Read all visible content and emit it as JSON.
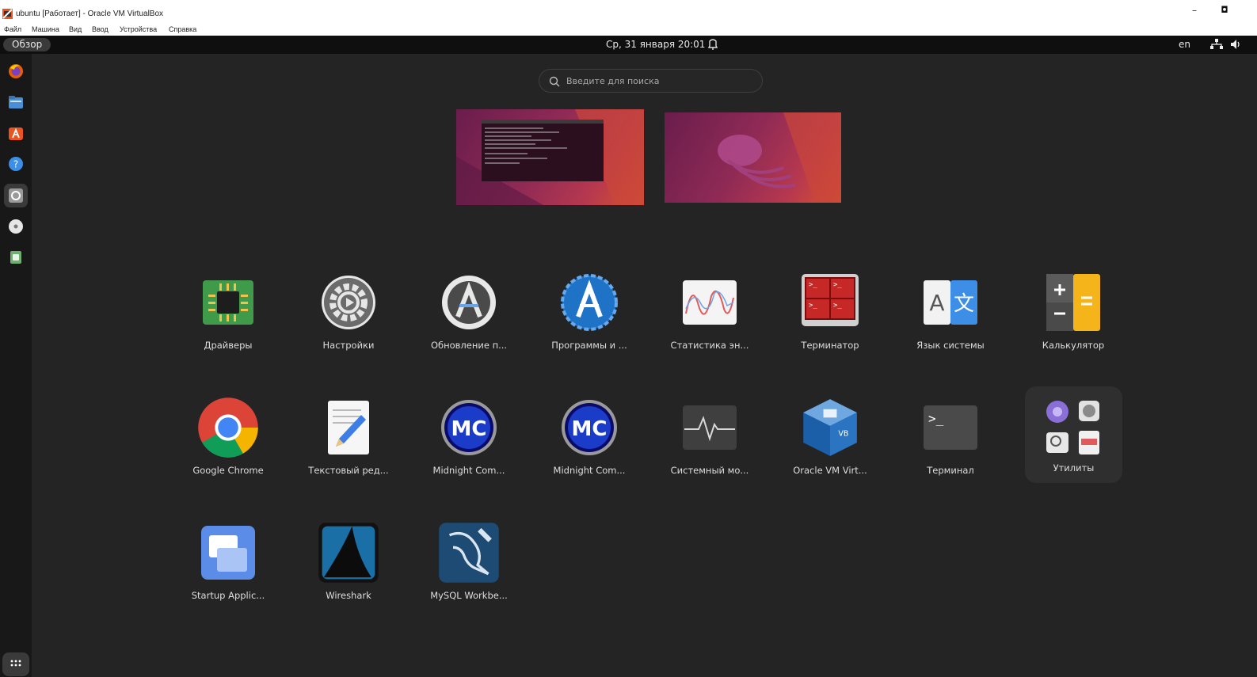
{
  "window": {
    "title": "ubuntu [Работает] - Oracle VM VirtualBox",
    "minimize": "–",
    "restore": "◘"
  },
  "menubar": [
    "Файл",
    "Машина",
    "Вид",
    "Ввод",
    "Устройства",
    "Справка"
  ],
  "topbar": {
    "activities": "Обзор",
    "clock": "Ср, 31 января  20:01",
    "lang": "en"
  },
  "search": {
    "placeholder": "Введите для поиска"
  },
  "dock": [
    {
      "name": "firefox-icon"
    },
    {
      "name": "files-icon"
    },
    {
      "name": "app-center-icon"
    },
    {
      "name": "help-icon"
    },
    {
      "name": "settings-icon",
      "active": true
    },
    {
      "name": "disc-icon"
    },
    {
      "name": "trash-icon"
    }
  ],
  "apps": [
    {
      "label": "Драйверы",
      "icon": "chip-icon"
    },
    {
      "label": "Настройки",
      "icon": "settings-gear-icon"
    },
    {
      "label": "Обновление п...",
      "icon": "software-updater-icon"
    },
    {
      "label": "Программы и ...",
      "icon": "software-properties-icon"
    },
    {
      "label": "Статистика эн...",
      "icon": "power-statistics-icon"
    },
    {
      "label": "Терминатор",
      "icon": "terminator-icon"
    },
    {
      "label": "Язык системы",
      "icon": "language-icon"
    },
    {
      "label": "Калькулятор",
      "icon": "calculator-icon"
    },
    {
      "label": "Google Chrome",
      "icon": "chrome-icon"
    },
    {
      "label": "Текстовый ред...",
      "icon": "text-editor-icon"
    },
    {
      "label": "Midnight Com...",
      "icon": "midnight-commander-icon"
    },
    {
      "label": "Midnight Com...",
      "icon": "midnight-commander-icon"
    },
    {
      "label": "Системный мо...",
      "icon": "system-monitor-icon"
    },
    {
      "label": "Oracle VM Virt...",
      "icon": "virtualbox-icon"
    },
    {
      "label": "Терминал",
      "icon": "terminal-icon"
    },
    {
      "label": "Утилиты",
      "icon": "utilities-folder-icon"
    },
    {
      "label": "Startup Applic...",
      "icon": "startup-apps-icon"
    },
    {
      "label": "Wireshark",
      "icon": "wireshark-icon"
    },
    {
      "label": "MySQL Workbe...",
      "icon": "mysql-workbench-icon"
    }
  ]
}
